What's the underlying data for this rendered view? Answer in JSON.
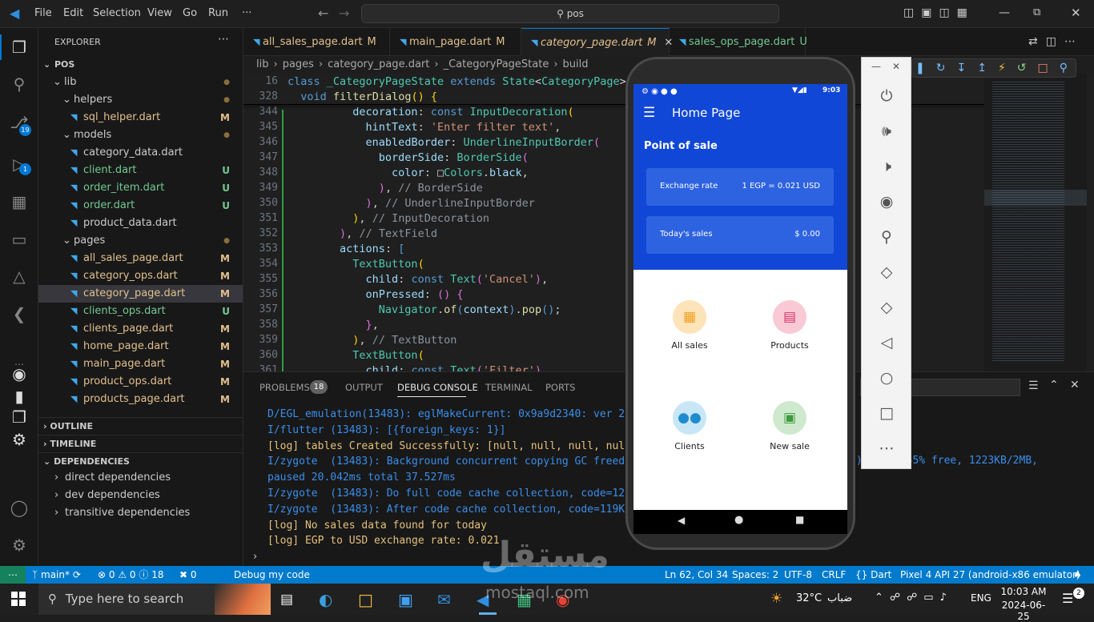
{
  "menu": [
    "File",
    "Edit",
    "Selection",
    "View",
    "Go",
    "Run",
    "···"
  ],
  "command_center": "pos",
  "activity_badges": {
    "source_control": "19",
    "debug": "1"
  },
  "explorer": {
    "title": "EXPLORER",
    "root": "POS",
    "items": [
      {
        "label": "lib",
        "status": "●",
        "indent": 1,
        "folder": true,
        "color": "#cccccc"
      },
      {
        "label": "helpers",
        "status": "●",
        "indent": 2,
        "folder": true,
        "color": "#cccccc"
      },
      {
        "label": "sql_helper.dart",
        "status": "M",
        "indent": 3,
        "folder": false,
        "color": "#e2c08d"
      },
      {
        "label": "models",
        "status": "●",
        "indent": 2,
        "folder": true,
        "color": "#cccccc"
      },
      {
        "label": "category_data.dart",
        "status": "",
        "indent": 3,
        "folder": false,
        "color": "#cccccc"
      },
      {
        "label": "client.dart",
        "status": "U",
        "indent": 3,
        "folder": false,
        "color": "#73c991"
      },
      {
        "label": "order_item.dart",
        "status": "U",
        "indent": 3,
        "folder": false,
        "color": "#73c991"
      },
      {
        "label": "order.dart",
        "status": "U",
        "indent": 3,
        "folder": false,
        "color": "#73c991"
      },
      {
        "label": "product_data.dart",
        "status": "",
        "indent": 3,
        "folder": false,
        "color": "#cccccc"
      },
      {
        "label": "pages",
        "status": "●",
        "indent": 2,
        "folder": true,
        "color": "#cccccc"
      },
      {
        "label": "all_sales_page.dart",
        "status": "M",
        "indent": 3,
        "folder": false,
        "color": "#e2c08d"
      },
      {
        "label": "category_ops.dart",
        "status": "M",
        "indent": 3,
        "folder": false,
        "color": "#e2c08d"
      },
      {
        "label": "category_page.dart",
        "status": "M",
        "indent": 3,
        "folder": false,
        "color": "#e2c08d",
        "selected": true
      },
      {
        "label": "clients_ops.dart",
        "status": "U",
        "indent": 3,
        "folder": false,
        "color": "#73c991"
      },
      {
        "label": "clients_page.dart",
        "status": "M",
        "indent": 3,
        "folder": false,
        "color": "#e2c08d"
      },
      {
        "label": "home_page.dart",
        "status": "M",
        "indent": 3,
        "folder": false,
        "color": "#e2c08d"
      },
      {
        "label": "main_page.dart",
        "status": "M",
        "indent": 3,
        "folder": false,
        "color": "#e2c08d"
      },
      {
        "label": "product_ops.dart",
        "status": "M",
        "indent": 3,
        "folder": false,
        "color": "#e2c08d"
      },
      {
        "label": "products_page.dart",
        "status": "M",
        "indent": 3,
        "folder": false,
        "color": "#e2c08d"
      }
    ],
    "sections": [
      "OUTLINE",
      "TIMELINE",
      "DEPENDENCIES"
    ],
    "dependencies": [
      "direct dependencies",
      "dev dependencies",
      "transitive dependencies"
    ]
  },
  "tabs": [
    {
      "label": "all_sales_page.dart",
      "status": "M",
      "active": false
    },
    {
      "label": "main_page.dart",
      "status": "M",
      "active": false
    },
    {
      "label": "category_page.dart",
      "status": "M",
      "active": true
    },
    {
      "label": "sales_ops_page.dart",
      "status": "U",
      "active": false
    }
  ],
  "breadcrumb": [
    "lib",
    "pages",
    "category_page.dart",
    "_CategoryPageState",
    "build"
  ],
  "code_lines": [
    {
      "n": "16",
      "html": "<span class=\"kw\">class</span> <span class=\"ty\">_CategoryPageState</span> <span class=\"kw\">extends</span> <span class=\"ty\">State</span><span class=\"pu\">&lt;</span><span class=\"ty\">CategoryPage</span><span class=\"pu\">&gt;</span>"
    },
    {
      "n": "328",
      "html": "  <span class=\"kw\">void</span> <span class=\"fn\">filterDialog</span><span class=\"yl\">()</span> <span class=\"yl\">{</span>"
    },
    {
      "n": "344",
      "html": "          <span class=\"pr\">decoration</span>: <span class=\"kw\">const</span> <span class=\"ty\">InputDecoration</span><span class=\"yl\">(</span>"
    },
    {
      "n": "345",
      "html": "            <span class=\"pr\">hintText</span>: <span class=\"str\">'Enter filter text'</span>,"
    },
    {
      "n": "346",
      "html": "            <span class=\"pr\">enabledBorder</span>: <span class=\"ty\">UnderlineInputBorder</span><span class=\"pk\">(</span>"
    },
    {
      "n": "347",
      "html": "              <span class=\"pr\">borderSide</span>: <span class=\"ty\">BorderSide</span><span class=\"pk\">(</span>"
    },
    {
      "n": "348",
      "html": "                <span class=\"pr\">color</span>: □<span class=\"ty\">Colors</span>.<span class=\"pr\">black</span>,"
    },
    {
      "n": "349",
      "html": "              <span class=\"pk\">)</span>, <span class=\"cm\">// BorderSide</span>"
    },
    {
      "n": "350",
      "html": "            <span class=\"pk\">)</span>, <span class=\"cm\">// UnderlineInputBorder</span>"
    },
    {
      "n": "351",
      "html": "          <span class=\"yl\">)</span>, <span class=\"cm\">// InputDecoration</span>"
    },
    {
      "n": "352",
      "html": "        <span class=\"pk\">)</span>, <span class=\"cm\">// TextField</span>"
    },
    {
      "n": "353",
      "html": "        <span class=\"pr\">actions</span>: <span class=\"kw\">[</span>"
    },
    {
      "n": "354",
      "html": "          <span class=\"ty\">TextButton</span><span class=\"yl\">(</span>"
    },
    {
      "n": "355",
      "html": "            <span class=\"pr\">child</span>: <span class=\"kw\">const</span> <span class=\"ty\">Text</span><span class=\"pk\">(</span><span class=\"str\">'Cancel'</span><span class=\"pk\">)</span>,"
    },
    {
      "n": "356",
      "html": "            <span class=\"pr\">onPressed</span>: <span class=\"pk\">()</span> <span class=\"pk\">{</span>"
    },
    {
      "n": "357",
      "html": "              <span class=\"ty\">Navigator</span>.<span class=\"fn\">of</span><span class=\"kw\">(</span><span class=\"pr\">context</span><span class=\"kw\">)</span>.<span class=\"fn\">pop</span><span class=\"kw\">()</span>;"
    },
    {
      "n": "358",
      "html": "            <span class=\"pk\">}</span>,"
    },
    {
      "n": "359",
      "html": "          <span class=\"yl\">)</span>, <span class=\"cm\">// TextButton</span>"
    },
    {
      "n": "360",
      "html": "          <span class=\"ty\">TextButton</span><span class=\"yl\">(</span>"
    },
    {
      "n": "361",
      "html": "            <span class=\"pr\">child</span>: <span class=\"kw\">const</span> <span class=\"ty\">Text</span><span class=\"pk\">(</span><span class=\"str\">'Filter'</span><span class=\"pk\">)</span>,"
    }
  ],
  "panel": {
    "tabs": [
      "PROBLEMS",
      "OUTPUT",
      "DEBUG CONSOLE",
      "TERMINAL",
      "PORTS"
    ],
    "problems_count": "18",
    "active_tab": "DEBUG CONSOLE",
    "logs": [
      {
        "text": "D/EGL_emulation(13483): eglMakeCurrent: 0x9a9d2340: ver 2",
        "color": "#3b8eea"
      },
      {
        "text": "I/flutter (13483): [{foreign_keys: 1}]",
        "color": "#3b8eea"
      },
      {
        "text": "[log] tables Created Successfully: [null, null, null, null",
        "color": "#e5c07b"
      },
      {
        "text": "I/zygote  (13483): Background concurrent copying GC freed",
        "color": "#3b8eea"
      },
      {
        "text": "paused 20.042ms total 37.527ms",
        "color": "#3b8eea"
      },
      {
        "text": "I/zygote  (13483): Do full code cache collection, code=122",
        "color": "#3b8eea"
      },
      {
        "text": "I/zygote  (13483): After code cache collection, code=119KB",
        "color": "#3b8eea"
      },
      {
        "text": "[log] No sales data found for today",
        "color": "#e5c07b"
      },
      {
        "text": "[log] EGP to USD exchange rate: 0.021",
        "color": "#e5c07b"
      }
    ],
    "log_tail": ") ects, 55% free, 1223KB/2MB,"
  },
  "status": {
    "branch": "main*",
    "errors": "0",
    "warnings": "0",
    "info": "18",
    "ports": "0",
    "debug": "Debug my code",
    "cursor": "Ln 62, Col 34",
    "spaces": "Spaces: 2",
    "encoding": "UTF-8",
    "eol": "CRLF",
    "language": "Dart",
    "device": "Pixel 4 API 27 (android-x86 emulator)"
  },
  "taskbar": {
    "search_placeholder": "Type here to search",
    "weather": "32°C",
    "weather_label": "ضباب",
    "lang": "ENG",
    "time": "10:03 AM",
    "date": "2024-06-25",
    "notifications": "2"
  },
  "phone": {
    "clock": "9:03",
    "app_title": "Home Page",
    "section_title": "Point of sale",
    "cards": [
      {
        "label": "Exchange rate",
        "value": "1 EGP = 0.021 USD"
      },
      {
        "label": "Today's sales",
        "value": "$ 0.00"
      }
    ],
    "tiles": [
      {
        "label": "All sales",
        "bg": "#fde3b8",
        "fg": "#f0a020",
        "glyph": "▦"
      },
      {
        "label": "Products",
        "bg": "#f9c9d5",
        "fg": "#d6336c",
        "glyph": "▤"
      },
      {
        "label": "Clients",
        "bg": "#c9e6f7",
        "fg": "#1f8ccf",
        "glyph": "●●"
      },
      {
        "label": "New sale",
        "bg": "#cfe9cf",
        "fg": "#3e9a3e",
        "glyph": "▣"
      }
    ]
  },
  "watermark": {
    "arabic": "مستقل",
    "latin": "mostaql.com"
  },
  "colors": {
    "accent": "#0078d4",
    "status_bar": "#007acc",
    "app_bar": "#1147d6"
  }
}
